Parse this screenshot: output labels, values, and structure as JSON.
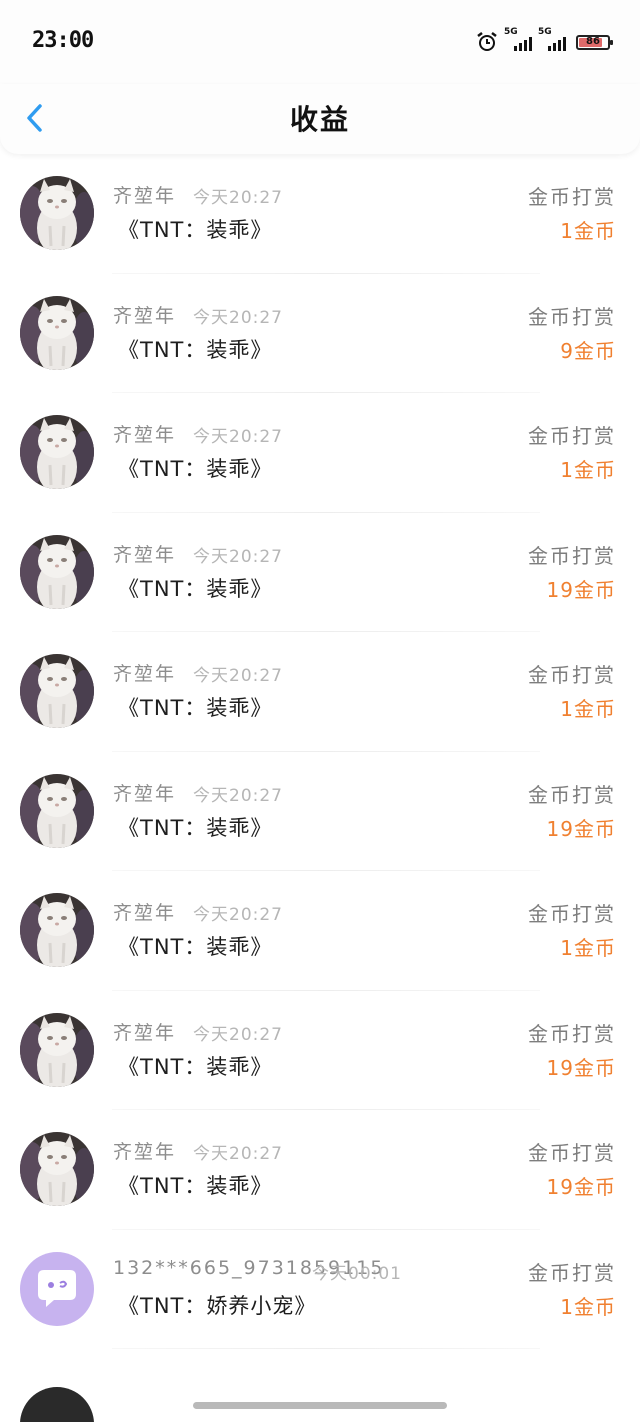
{
  "status_bar": {
    "time": "23:00",
    "network_1": "5G",
    "network_2": "5G",
    "battery_level": "86"
  },
  "header": {
    "back_icon": "chevron-left-icon",
    "title": "收益"
  },
  "colors": {
    "accent_blue": "#2f9cf0",
    "amount_orange": "#f08030"
  },
  "records": [
    {
      "name": "齐堃年",
      "time": "今天20:27",
      "work": "《TNT：装乖》",
      "type": "金币打赏",
      "amount": "1金币"
    },
    {
      "name": "齐堃年",
      "time": "今天20:27",
      "work": "《TNT：装乖》",
      "type": "金币打赏",
      "amount": "9金币"
    },
    {
      "name": "齐堃年",
      "time": "今天20:27",
      "work": "《TNT：装乖》",
      "type": "金币打赏",
      "amount": "1金币"
    },
    {
      "name": "齐堃年",
      "time": "今天20:27",
      "work": "《TNT：装乖》",
      "type": "金币打赏",
      "amount": "19金币"
    },
    {
      "name": "齐堃年",
      "time": "今天20:27",
      "work": "《TNT：装乖》",
      "type": "金币打赏",
      "amount": "1金币"
    },
    {
      "name": "齐堃年",
      "time": "今天20:27",
      "work": "《TNT：装乖》",
      "type": "金币打赏",
      "amount": "19金币"
    },
    {
      "name": "齐堃年",
      "time": "今天20:27",
      "work": "《TNT：装乖》",
      "type": "金币打赏",
      "amount": "1金币"
    },
    {
      "name": "齐堃年",
      "time": "今天20:27",
      "work": "《TNT：装乖》",
      "type": "金币打赏",
      "amount": "19金币"
    },
    {
      "name": "齐堃年",
      "time": "今天20:27",
      "work": "《TNT：装乖》",
      "type": "金币打赏",
      "amount": "19金币"
    },
    {
      "name": "132***665_9731859115",
      "time": "今天00:01",
      "work": "《TNT：娇养小宠》",
      "type": "金币打赏",
      "amount": "1金币"
    }
  ]
}
